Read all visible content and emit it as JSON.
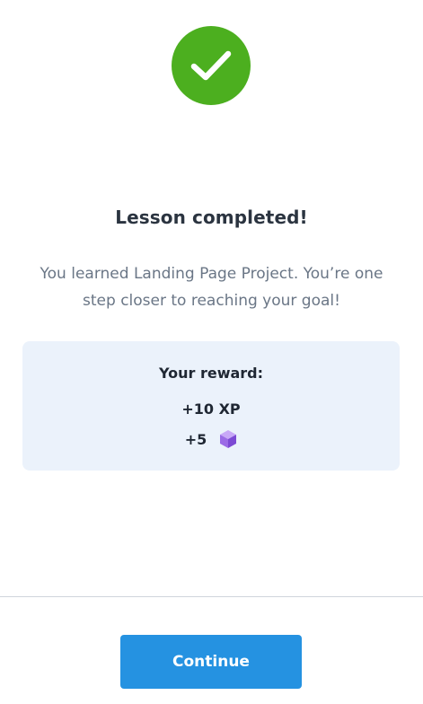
{
  "status": {
    "icon": "checkmark-icon",
    "color": "#4caf1f"
  },
  "title": "Lesson completed!",
  "subtitle": "You learned Landing Page Project. You’re one step closer to reaching your goal!",
  "reward": {
    "heading": "Your reward:",
    "xp": "+10 XP",
    "gems": "+5",
    "gem_icon": "purple-gem-icon",
    "background": "#ebf2fb"
  },
  "actions": {
    "continue_label": "Continue",
    "accent": "#2592e1"
  }
}
